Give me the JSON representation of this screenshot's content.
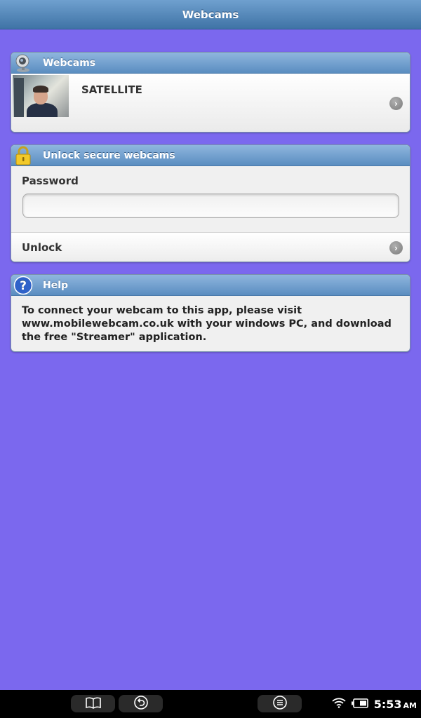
{
  "app": {
    "title": "Webcams"
  },
  "webcams_panel": {
    "header": "Webcams",
    "items": [
      {
        "name": "SATELLITE"
      }
    ]
  },
  "unlock_panel": {
    "header": "Unlock secure webcams",
    "password_label": "Password",
    "password_value": "",
    "unlock_label": "Unlock"
  },
  "help_panel": {
    "header": "Help",
    "text": "To connect your webcam to this app, please visit www.mobilewebcam.co.uk with your windows PC, and download the free \"Streamer\" application."
  },
  "status_bar": {
    "time": "5:53",
    "ampm": "AM",
    "icons": [
      "wifi-icon",
      "battery-icon"
    ]
  },
  "nav_bar": {
    "buttons": [
      "book-icon",
      "back-icon",
      "menu-icon"
    ]
  },
  "colors": {
    "background": "#7b68ee",
    "header_blue": "#5a8dc0",
    "titlebar_blue": "#3f73a6"
  }
}
